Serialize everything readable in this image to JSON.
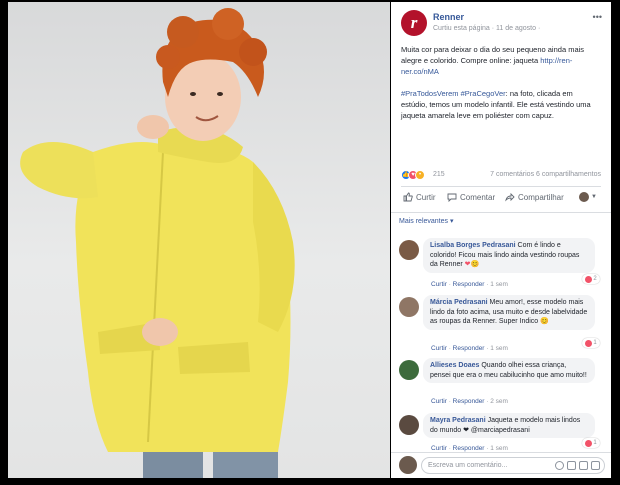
{
  "page": {
    "name": "Renner",
    "meta": "Curtiu esta página · 11 de agosto ·"
  },
  "post": {
    "line1": "Muita cor para deixar o dia do seu pequeno ainda mais alegre e colorido. Compre online: jaqueta",
    "link": "http://ren-ner.co/nMA",
    "line2_tags": "#PraTodosVerem #PraCegoVer",
    "line2": ": na foto, clicada em estúdio, temos um modelo infantil. Ele está vestindo uma jaqueta amarela leve em poliéster com capuz."
  },
  "reactions": {
    "count": "215",
    "summary": "7 comentários  6 compartilhamentos"
  },
  "actions": {
    "like": "Curtir",
    "comment": "Comentar",
    "share": "Compartilhar"
  },
  "relevance": {
    "label": "Mais relevantes ▾"
  },
  "comments": [
    {
      "name": "Lisalba Borges Pedrasani",
      "text": " Com é lindo e colorido! Ficou mais lindo ainda vestindo roupas da Renner",
      "like": "Curtir",
      "reply": "Responder",
      "time": "1 sem",
      "count": "2"
    },
    {
      "name": "Márcia Pedrasani",
      "text": " Meu amor!, esse modelo mais lindo da foto acima, usa muito e desde labelvidade as roupas da Renner. Super Indico",
      "like": "Curtir",
      "reply": "Responder",
      "time": "1 sem",
      "count": "1"
    },
    {
      "name": "Allieses Doaes",
      "text": " Quando olhei essa criança, pensei que era o meu cabilucinho que amo muito!!",
      "like": "Curtir",
      "reply": "Responder",
      "time": "2 sem",
      "count": ""
    },
    {
      "name": "Mayra Pedrasani",
      "text": " Jaqueta e modelo mais lindos do mundo ❤ @marciapedrasani",
      "like": "Curtir",
      "reply": "Responder",
      "time": "1 sem",
      "count": "1"
    }
  ],
  "composer": {
    "placeholder": "Escreva um comentário..."
  },
  "colors": {
    "brand": "#b3122b",
    "link": "#365899",
    "jacket": "#f1e35a"
  }
}
